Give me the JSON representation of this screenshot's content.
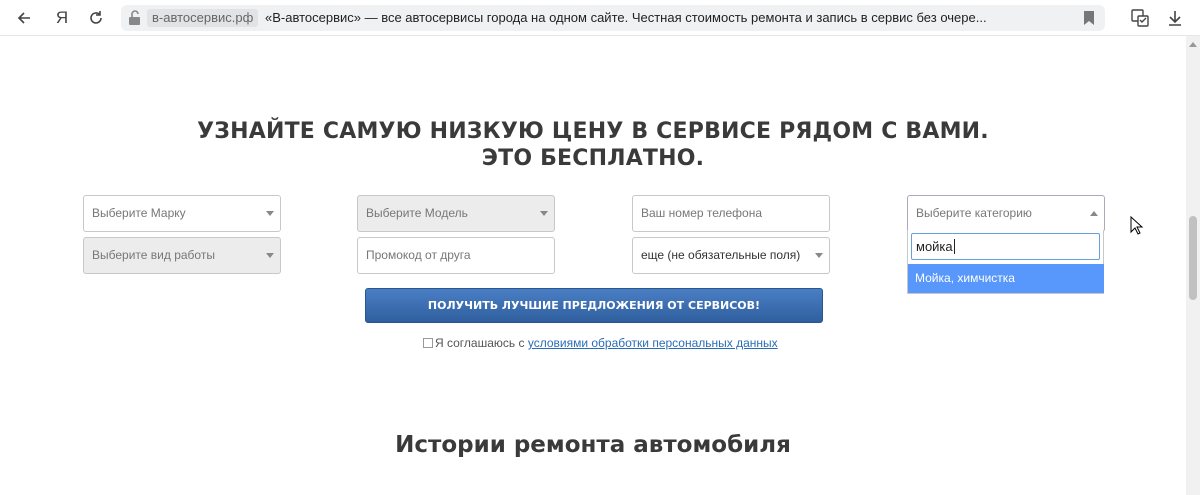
{
  "browser": {
    "domain": "в-автосервис.рф",
    "title": "«В-автосервис» — все автосервисы города на одном сайте. Честная стоимость ремонта и запись в сервис без очере...",
    "icons": [
      "back-arrow-icon",
      "yandex-logo-icon",
      "reload-icon",
      "lock-icon",
      "bookmark-icon",
      "translate-icon",
      "download-icon"
    ],
    "yandex_glyph": "Я"
  },
  "hero": {
    "line1": "УЗНАЙТЕ САМУЮ НИЗКУЮ ЦЕНУ В СЕРВИСЕ РЯДОМ С ВАМИ.",
    "line2": "ЭТО БЕСПЛАТНО."
  },
  "form": {
    "brand_placeholder": "Выберите Марку",
    "model_placeholder": "Выберите Модель",
    "phone_placeholder": "Ваш номер телефона",
    "category_placeholder": "Выберите категорию",
    "work_placeholder": "Выберите вид работы",
    "promo_placeholder": "Промокод от друга",
    "more_value": "еще (не обязательные поля)",
    "category_search_value": "мойка",
    "category_option": "Мойка, химчистка",
    "submit_label": "ПОЛУЧИТЬ ЛУЧШИЕ ПРЕДЛОЖЕНИЯ ОТ СЕРВИСОВ!",
    "agree_text": "Я соглашаюсь с ",
    "agree_link": "условиями обработки персональных данных"
  },
  "section": {
    "title": "Истории ремонта автомобиля"
  },
  "colors": {
    "accent": "#2f5f9e",
    "highlight": "#5897fb",
    "link": "#2a6db5"
  }
}
